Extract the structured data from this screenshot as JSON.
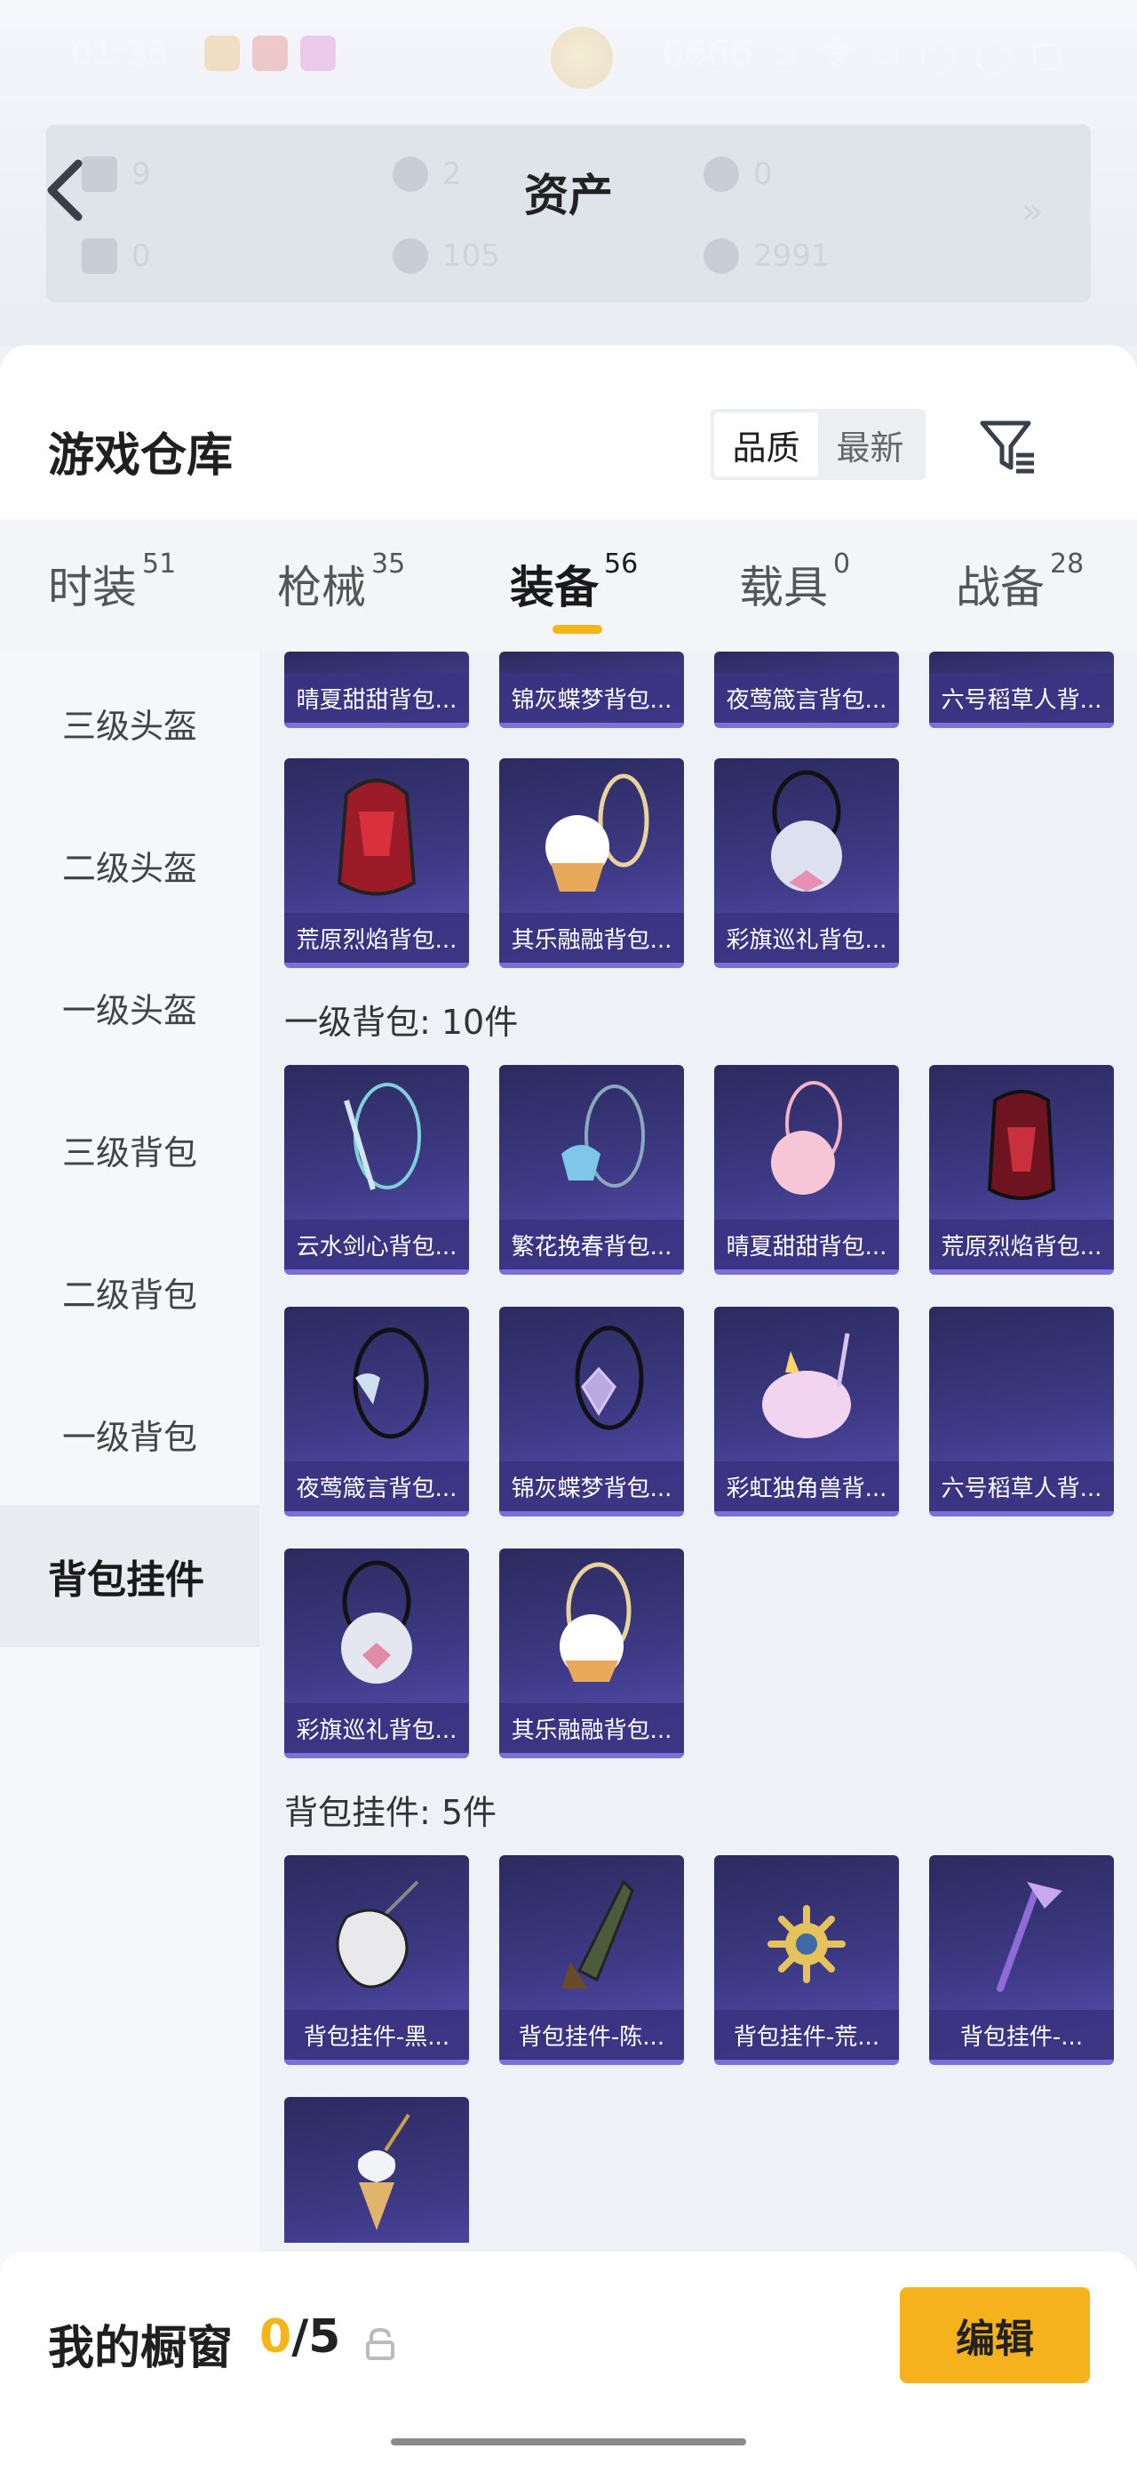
{
  "status_bar": {
    "time": "01:36",
    "center_text": "6666",
    "right_text": "⊿ 令 ▭ ◯ ◯ ▢"
  },
  "assets": {
    "title": "资产",
    "items": [
      {
        "value": "9",
        "icon": "ticket-icon"
      },
      {
        "value": "2",
        "icon": "coin-icon"
      },
      {
        "value": "0",
        "icon": "coin-gold-icon"
      },
      {
        "value": "0",
        "icon": "card-icon"
      },
      {
        "value": "105",
        "icon": "silver-coin-icon"
      },
      {
        "value": "2991",
        "icon": "gold-coin-icon"
      }
    ],
    "more": "»"
  },
  "warehouse": {
    "title": "游戏仓库",
    "sort_options": [
      "品质",
      "最新"
    ],
    "active_sort": "品质"
  },
  "tabs": [
    {
      "label": "时装",
      "count": "51"
    },
    {
      "label": "枪械",
      "count": "35"
    },
    {
      "label": "装备",
      "count": "56",
      "active": true
    },
    {
      "label": "载具",
      "count": "0"
    },
    {
      "label": "战备",
      "count": "28"
    }
  ],
  "sidebar": [
    {
      "label": "三级头盔"
    },
    {
      "label": "二级头盔"
    },
    {
      "label": "一级头盔"
    },
    {
      "label": "三级背包"
    },
    {
      "label": "二级背包"
    },
    {
      "label": "一级背包"
    },
    {
      "label": "背包挂件",
      "active": true
    }
  ],
  "groups": {
    "top_partial": [
      "晴夏甜甜背包...",
      "锦灰蝶梦背包...",
      "夜莺箴言背包...",
      "六号稻草人背..."
    ],
    "level2_rest": [
      "荒原烈焰背包...",
      "其乐融融背包...",
      "彩旗巡礼背包..."
    ],
    "level1": {
      "title": "一级背包: 10件",
      "items": [
        "云水剑心背包...",
        "繁花挽春背包...",
        "晴夏甜甜背包...",
        "荒原烈焰背包...",
        "夜莺箴言背包...",
        "锦灰蝶梦背包...",
        "彩虹独角兽背...",
        "六号稻草人背...",
        "彩旗巡礼背包...",
        "其乐融融背包..."
      ]
    },
    "pendants": {
      "title": "背包挂件: 5件",
      "items": [
        "背包挂件-黑...",
        "背包挂件-陈...",
        "背包挂件-荒...",
        "背包挂件-...",
        ""
      ]
    }
  },
  "showcase": {
    "label": "我的橱窗",
    "current": "0",
    "total": "/5",
    "edit_label": "编辑"
  },
  "colors": {
    "accent": "#f6b21d",
    "card_bg": "#3e3a86"
  }
}
